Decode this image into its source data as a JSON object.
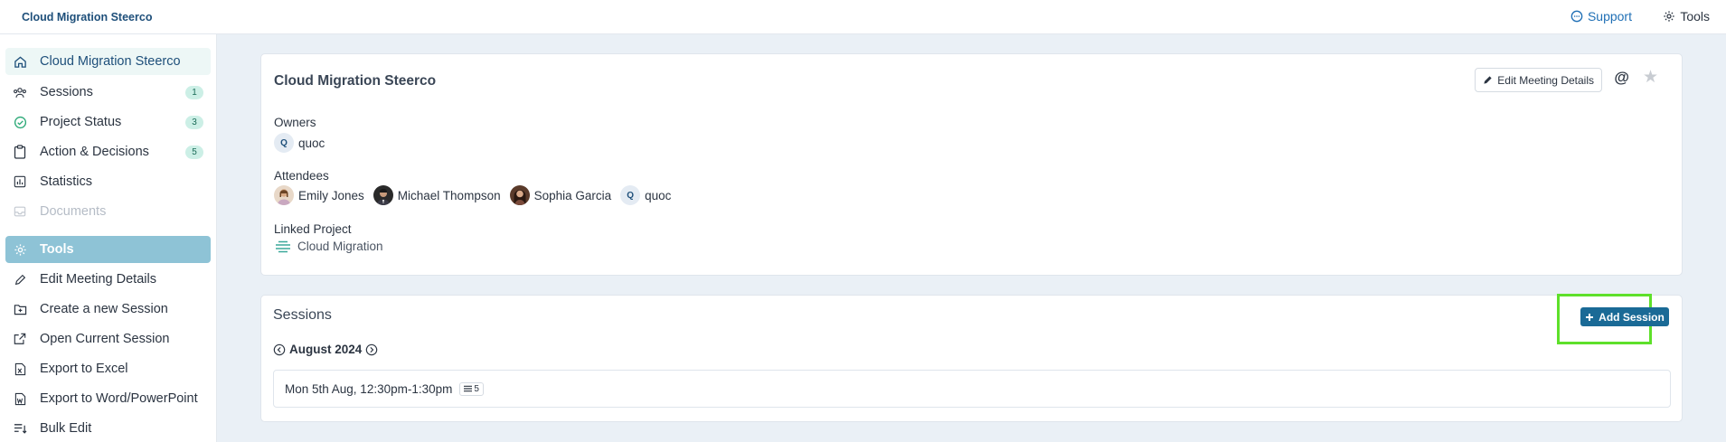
{
  "topbar": {
    "brand": "Cloud Migration Steerco",
    "support_label": "Support",
    "tools_label": "Tools"
  },
  "sidebar": {
    "items": [
      {
        "label": "Cloud Migration Steerco",
        "icon": "home-icon"
      },
      {
        "label": "Sessions",
        "icon": "users-icon",
        "badge": "1"
      },
      {
        "label": "Project Status",
        "icon": "check-circle-icon",
        "badge": "3"
      },
      {
        "label": "Action & Decisions",
        "icon": "clipboard-icon",
        "badge": "5"
      },
      {
        "label": "Statistics",
        "icon": "chart-icon"
      },
      {
        "label": "Documents",
        "icon": "inbox-icon"
      }
    ],
    "tools_header": "Tools",
    "tools": [
      {
        "label": "Edit Meeting Details",
        "icon": "pencil-icon"
      },
      {
        "label": "Create a new Session",
        "icon": "folder-plus-icon"
      },
      {
        "label": "Open Current Session",
        "icon": "external-link-icon"
      },
      {
        "label": "Export to Excel",
        "icon": "excel-file-icon"
      },
      {
        "label": "Export to Word/PowerPoint",
        "icon": "word-file-icon"
      },
      {
        "label": "Bulk Edit",
        "icon": "bulk-edit-icon"
      }
    ]
  },
  "meeting": {
    "title": "Cloud Migration Steerco",
    "edit_label": "Edit Meeting Details",
    "at_symbol": "@",
    "owners_label": "Owners",
    "owners": [
      {
        "initial": "Q",
        "name": "quoc"
      }
    ],
    "attendees_label": "Attendees",
    "attendees": [
      {
        "name": "Emily Jones"
      },
      {
        "name": "Michael Thompson"
      },
      {
        "name": "Sophia Garcia"
      },
      {
        "name": "quoc",
        "initial": "Q"
      }
    ],
    "linked_project_label": "Linked Project",
    "linked_project": "Cloud Migration"
  },
  "sessions": {
    "title": "Sessions",
    "add_label": "Add Session",
    "month": "August 2024",
    "rows": [
      {
        "when": "Mon 5th Aug, 12:30pm-1:30pm",
        "count": "5"
      }
    ]
  },
  "colors": {
    "accent": "#1a6a96",
    "highlight": "#5ee02a",
    "tools_bg": "#8ec3d6"
  }
}
